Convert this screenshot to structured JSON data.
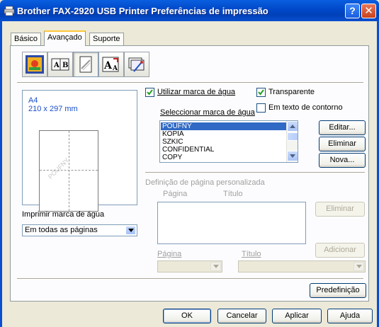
{
  "window": {
    "title": "Brother FAX-2920 USB Printer Preferências de impressão",
    "help_label": "?",
    "close_label": "✕"
  },
  "tabs": [
    {
      "label": "Básico",
      "active": false
    },
    {
      "label": "Avançado",
      "active": true
    },
    {
      "label": "Suporte",
      "active": false
    }
  ],
  "toolbar_icons": [
    "quality-icon",
    "duplex-icon",
    "watermark-icon",
    "scaling-icon",
    "settings-icon"
  ],
  "preview": {
    "paper_name": "A4",
    "paper_size": "210 x 297 mm",
    "watermark_sample": "POUFNY"
  },
  "print_watermark": {
    "label_prefix": "",
    "label": "Imprimir marca de água",
    "selected": "Em todas as páginas"
  },
  "watermark": {
    "use_label": "Utilizar marca de água",
    "use_checked": true,
    "transparent_label": "Transparente",
    "transparent_checked": true,
    "outline_label": "Em texto de contorno",
    "outline_checked": false,
    "select_label": "Seleccionar marca de água",
    "items": [
      "POUFNY",
      "KOPIA",
      "SZKIC",
      "CONFIDENTIAL",
      "COPY"
    ],
    "selected_index": 0
  },
  "buttons": {
    "edit": "Editar...",
    "delete": "Eliminar",
    "new": "Nova..."
  },
  "custom_page": {
    "section_label": "Definição de página personalizada",
    "col_page": "Página",
    "col_title": "Título",
    "delete": "Eliminar",
    "add": "Adicionar",
    "page_label": "Página",
    "title_label": "Título"
  },
  "footer": {
    "default_button": "Predefinição",
    "ok": "OK",
    "cancel": "Cancelar",
    "apply": "Aplicar",
    "help": "Ajuda"
  }
}
